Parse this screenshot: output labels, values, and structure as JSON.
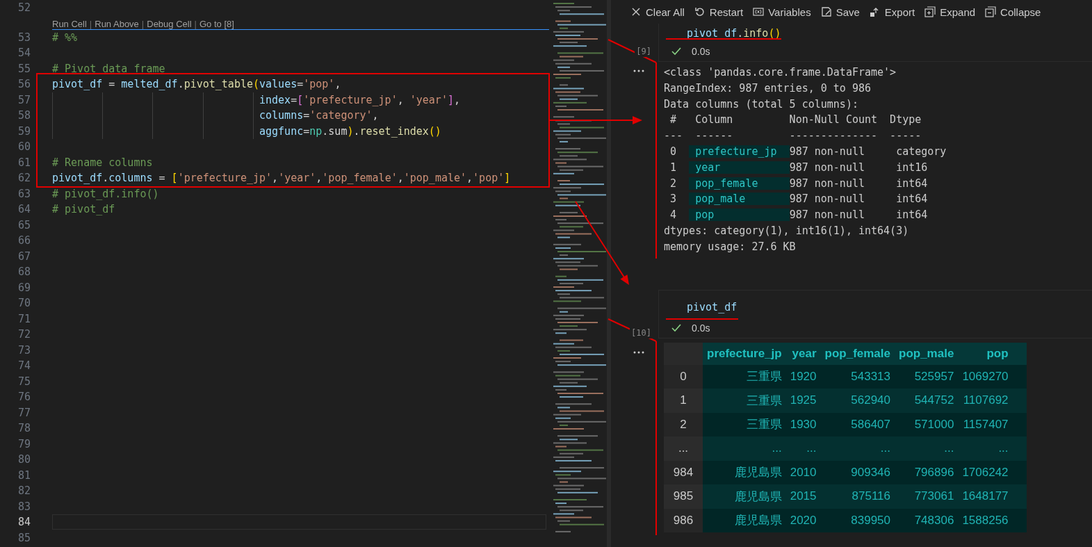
{
  "editor": {
    "lines": [
      {
        "kind": "code",
        "number": "52",
        "current": false
      },
      {
        "kind": "codelens",
        "items": [
          {
            "kind": "link",
            "text": "Run Cell"
          },
          {
            "kind": "separator",
            "text": "|"
          },
          {
            "kind": "link",
            "text": "Run Above"
          },
          {
            "kind": "separator",
            "text": "|"
          },
          {
            "kind": "link",
            "text": "Debug Cell"
          },
          {
            "kind": "separator",
            "text": "|"
          },
          {
            "kind": "link",
            "text": "Go to [8]"
          }
        ]
      },
      {
        "kind": "code",
        "number": "53",
        "current": false,
        "tokens": [
          {
            "kind": "comment",
            "text": "# %%"
          }
        ]
      },
      {
        "kind": "code",
        "number": "54",
        "current": false
      },
      {
        "kind": "code",
        "number": "55",
        "current": false,
        "tokens": [
          {
            "kind": "comment",
            "text": "# Pivot data frame"
          }
        ]
      },
      {
        "kind": "code",
        "number": "56",
        "current": false,
        "tokens": [
          {
            "kind": "var",
            "text": "pivot_df"
          },
          {
            "kind": "op",
            "text": " = "
          },
          {
            "kind": "var",
            "text": "melted_df"
          },
          {
            "kind": "op",
            "text": "."
          },
          {
            "kind": "func",
            "text": "pivot_table"
          },
          {
            "kind": "bracket1",
            "text": "("
          },
          {
            "kind": "var",
            "text": "values"
          },
          {
            "kind": "op",
            "text": "="
          },
          {
            "kind": "str",
            "text": "'pop'"
          },
          {
            "kind": "op",
            "text": ","
          }
        ]
      },
      {
        "kind": "code",
        "number": "57",
        "current": false,
        "hanging_indent": true,
        "tokens": [
          {
            "kind": "var",
            "text": "index"
          },
          {
            "kind": "op",
            "text": "="
          },
          {
            "kind": "bracket2",
            "text": "["
          },
          {
            "kind": "str",
            "text": "'prefecture_jp'"
          },
          {
            "kind": "op",
            "text": ", "
          },
          {
            "kind": "str",
            "text": "'year'"
          },
          {
            "kind": "bracket2",
            "text": "]"
          },
          {
            "kind": "op",
            "text": ","
          }
        ]
      },
      {
        "kind": "code",
        "number": "58",
        "current": false,
        "hanging_indent": true,
        "tokens": [
          {
            "kind": "var",
            "text": "columns"
          },
          {
            "kind": "op",
            "text": "="
          },
          {
            "kind": "str",
            "text": "'category'"
          },
          {
            "kind": "op",
            "text": ","
          }
        ]
      },
      {
        "kind": "code",
        "number": "59",
        "current": false,
        "hanging_indent": true,
        "tokens": [
          {
            "kind": "var",
            "text": "aggfunc"
          },
          {
            "kind": "op",
            "text": "="
          },
          {
            "kind": "module",
            "text": "np"
          },
          {
            "kind": "op",
            "text": ".sum"
          },
          {
            "kind": "bracket1",
            "text": ")"
          },
          {
            "kind": "op",
            "text": "."
          },
          {
            "kind": "func",
            "text": "reset_index"
          },
          {
            "kind": "bracket1",
            "text": "()"
          }
        ]
      },
      {
        "kind": "code",
        "number": "60",
        "current": false
      },
      {
        "kind": "code",
        "number": "61",
        "current": false,
        "tokens": [
          {
            "kind": "comment",
            "text": "# Rename columns"
          }
        ]
      },
      {
        "kind": "code",
        "number": "62",
        "current": false,
        "tokens": [
          {
            "kind": "var",
            "text": "pivot_df"
          },
          {
            "kind": "op",
            "text": "."
          },
          {
            "kind": "var",
            "text": "columns"
          },
          {
            "kind": "op",
            "text": " = "
          },
          {
            "kind": "bracket1",
            "text": "["
          },
          {
            "kind": "str",
            "text": "'prefecture_jp'"
          },
          {
            "kind": "op",
            "text": ","
          },
          {
            "kind": "str",
            "text": "'year'"
          },
          {
            "kind": "op",
            "text": ","
          },
          {
            "kind": "str",
            "text": "'pop_female'"
          },
          {
            "kind": "op",
            "text": ","
          },
          {
            "kind": "str",
            "text": "'pop_male'"
          },
          {
            "kind": "op",
            "text": ","
          },
          {
            "kind": "str",
            "text": "'pop'"
          },
          {
            "kind": "bracket1",
            "text": "]"
          }
        ]
      },
      {
        "kind": "code",
        "number": "63",
        "current": false,
        "tokens": [
          {
            "kind": "comment",
            "text": "# pivot_df.info()"
          }
        ]
      },
      {
        "kind": "code",
        "number": "64",
        "current": false,
        "tokens": [
          {
            "kind": "comment",
            "text": "# pivot_df"
          }
        ]
      },
      {
        "kind": "code",
        "number": "65",
        "current": false
      },
      {
        "kind": "code",
        "number": "66",
        "current": false
      },
      {
        "kind": "code",
        "number": "67",
        "current": false
      },
      {
        "kind": "code",
        "number": "68",
        "current": false
      },
      {
        "kind": "code",
        "number": "69",
        "current": false
      },
      {
        "kind": "code",
        "number": "70",
        "current": false
      },
      {
        "kind": "code",
        "number": "71",
        "current": false
      },
      {
        "kind": "code",
        "number": "72",
        "current": false
      },
      {
        "kind": "code",
        "number": "73",
        "current": false
      },
      {
        "kind": "code",
        "number": "74",
        "current": false
      },
      {
        "kind": "code",
        "number": "75",
        "current": false
      },
      {
        "kind": "code",
        "number": "76",
        "current": false
      },
      {
        "kind": "code",
        "number": "77",
        "current": false
      },
      {
        "kind": "code",
        "number": "78",
        "current": false
      },
      {
        "kind": "code",
        "number": "79",
        "current": false
      },
      {
        "kind": "code",
        "number": "80",
        "current": false
      },
      {
        "kind": "code",
        "number": "81",
        "current": false
      },
      {
        "kind": "code",
        "number": "82",
        "current": false
      },
      {
        "kind": "code",
        "number": "83",
        "current": false
      },
      {
        "kind": "code",
        "number": "84",
        "current": true
      },
      {
        "kind": "code",
        "number": "85",
        "current": false
      }
    ]
  },
  "notebook": {
    "toolbar": [
      {
        "kind": "clear",
        "label": "Clear All"
      },
      {
        "kind": "restart",
        "label": "Restart"
      },
      {
        "kind": "variables",
        "label": "Variables"
      },
      {
        "kind": "save",
        "label": "Save"
      },
      {
        "kind": "export",
        "label": "Export"
      },
      {
        "kind": "expand",
        "label": "Expand"
      },
      {
        "kind": "collapse",
        "label": "Collapse"
      }
    ],
    "cells": [
      {
        "execution_count": "[9]",
        "succeeded": true,
        "duration": "0.0s",
        "code": [
          {
            "kind": "var",
            "text": "pivot_df"
          },
          {
            "kind": "op",
            "text": "."
          },
          {
            "kind": "func",
            "text": "info"
          },
          {
            "kind": "bracket1",
            "text": "()"
          }
        ],
        "output": {
          "kind": "text",
          "lines": [
            [
              {
                "text": "<class 'pandas.core.frame.DataFrame'>",
                "highlighted": false
              }
            ],
            [
              {
                "text": "RangeIndex: 987 entries, 0 to 986",
                "highlighted": false
              }
            ],
            [
              {
                "text": "Data columns (total 5 columns):",
                "highlighted": false
              }
            ],
            [
              {
                "text": " #   Column         Non-Null Count  Dtype",
                "highlighted": false
              }
            ],
            [
              {
                "text": "---  ------         --------------  -----",
                "highlighted": false
              }
            ],
            [
              {
                "text": " 0  ",
                "highlighted": false
              },
              {
                "text": " prefecture_jp  ",
                "highlighted": true
              },
              {
                "text": "987 non-null     category",
                "highlighted": false
              }
            ],
            [
              {
                "text": " 1  ",
                "highlighted": false
              },
              {
                "text": " year           ",
                "highlighted": true
              },
              {
                "text": "987 non-null     int16",
                "highlighted": false
              }
            ],
            [
              {
                "text": " 2  ",
                "highlighted": false
              },
              {
                "text": " pop_female     ",
                "highlighted": true
              },
              {
                "text": "987 non-null     int64",
                "highlighted": false
              }
            ],
            [
              {
                "text": " 3  ",
                "highlighted": false
              },
              {
                "text": " pop_male       ",
                "highlighted": true
              },
              {
                "text": "987 non-null     int64",
                "highlighted": false
              }
            ],
            [
              {
                "text": " 4  ",
                "highlighted": false
              },
              {
                "text": " pop            ",
                "highlighted": true
              },
              {
                "text": "987 non-null     int64",
                "highlighted": false
              }
            ],
            [
              {
                "text": "dtypes: category(1), int16(1), int64(3)",
                "highlighted": false
              }
            ],
            [
              {
                "text": "memory usage: 27.6 KB",
                "highlighted": false
              }
            ]
          ]
        }
      },
      {
        "execution_count": "[10]",
        "succeeded": true,
        "duration": "0.0s",
        "code": [
          {
            "kind": "var",
            "text": "pivot_df"
          }
        ],
        "output": {
          "kind": "table",
          "columns": [
            "prefecture_jp",
            "year",
            "pop_female",
            "pop_male",
            "pop"
          ],
          "rows": [
            {
              "index": "0",
              "cells": [
                "三重県",
                "1920",
                "543313",
                "525957",
                "1069270"
              ]
            },
            {
              "index": "1",
              "cells": [
                "三重県",
                "1925",
                "562940",
                "544752",
                "1107692"
              ]
            },
            {
              "index": "2",
              "cells": [
                "三重県",
                "1930",
                "586407",
                "571000",
                "1157407"
              ]
            },
            {
              "index": "...",
              "cells": [
                "...",
                "...",
                "...",
                "...",
                "..."
              ]
            },
            {
              "index": "984",
              "cells": [
                "鹿児島県",
                "2010",
                "909346",
                "796896",
                "1706242"
              ]
            },
            {
              "index": "985",
              "cells": [
                "鹿児島県",
                "2015",
                "875116",
                "773061",
                "1648177"
              ]
            },
            {
              "index": "986",
              "cells": [
                "鹿児島県",
                "2020",
                "839950",
                "748306",
                "1588256"
              ]
            }
          ]
        }
      }
    ]
  }
}
